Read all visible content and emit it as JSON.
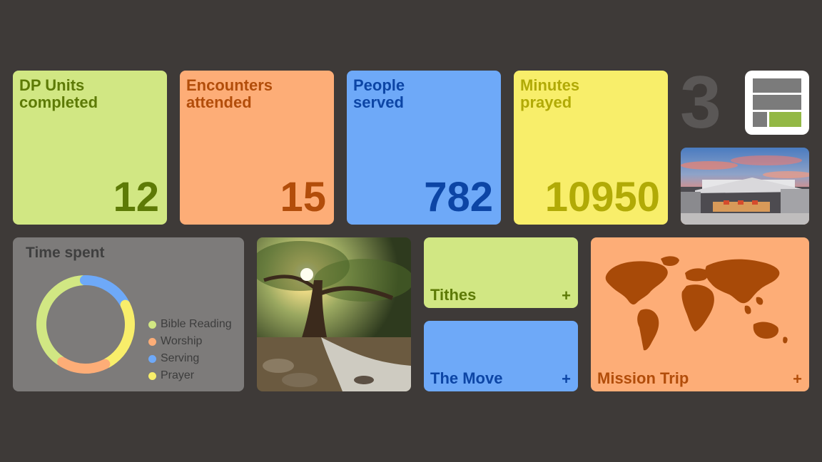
{
  "stats": [
    {
      "title_line1": "DP Units",
      "title_line2": "completed",
      "value": "12"
    },
    {
      "title_line1": "Encounters",
      "title_line2": "attended",
      "value": "15"
    },
    {
      "title_line1": "People",
      "title_line2": "served",
      "value": "782"
    },
    {
      "title_line1": "Minutes",
      "title_line2": "prayed",
      "value": "10950"
    }
  ],
  "big_number": "3",
  "time_spent": {
    "title": "Time spent",
    "legend": [
      {
        "label": "Bible Reading",
        "color": "#d1e783"
      },
      {
        "label": "Worship",
        "color": "#fdad77"
      },
      {
        "label": "Serving",
        "color": "#6ea9f8"
      },
      {
        "label": "Prayer",
        "color": "#f8ee6a"
      }
    ],
    "share": [
      0.4,
      0.17,
      0.18,
      0.25
    ]
  },
  "actions": {
    "tithes": {
      "label": "Tithes",
      "plus": "+"
    },
    "the_move": {
      "label": "The Move",
      "plus": "+"
    },
    "mission_trip": {
      "label": "Mission Trip",
      "plus": "+"
    }
  },
  "icons": {
    "layout": "layout-grid-icon",
    "plus": "plus-icon"
  }
}
